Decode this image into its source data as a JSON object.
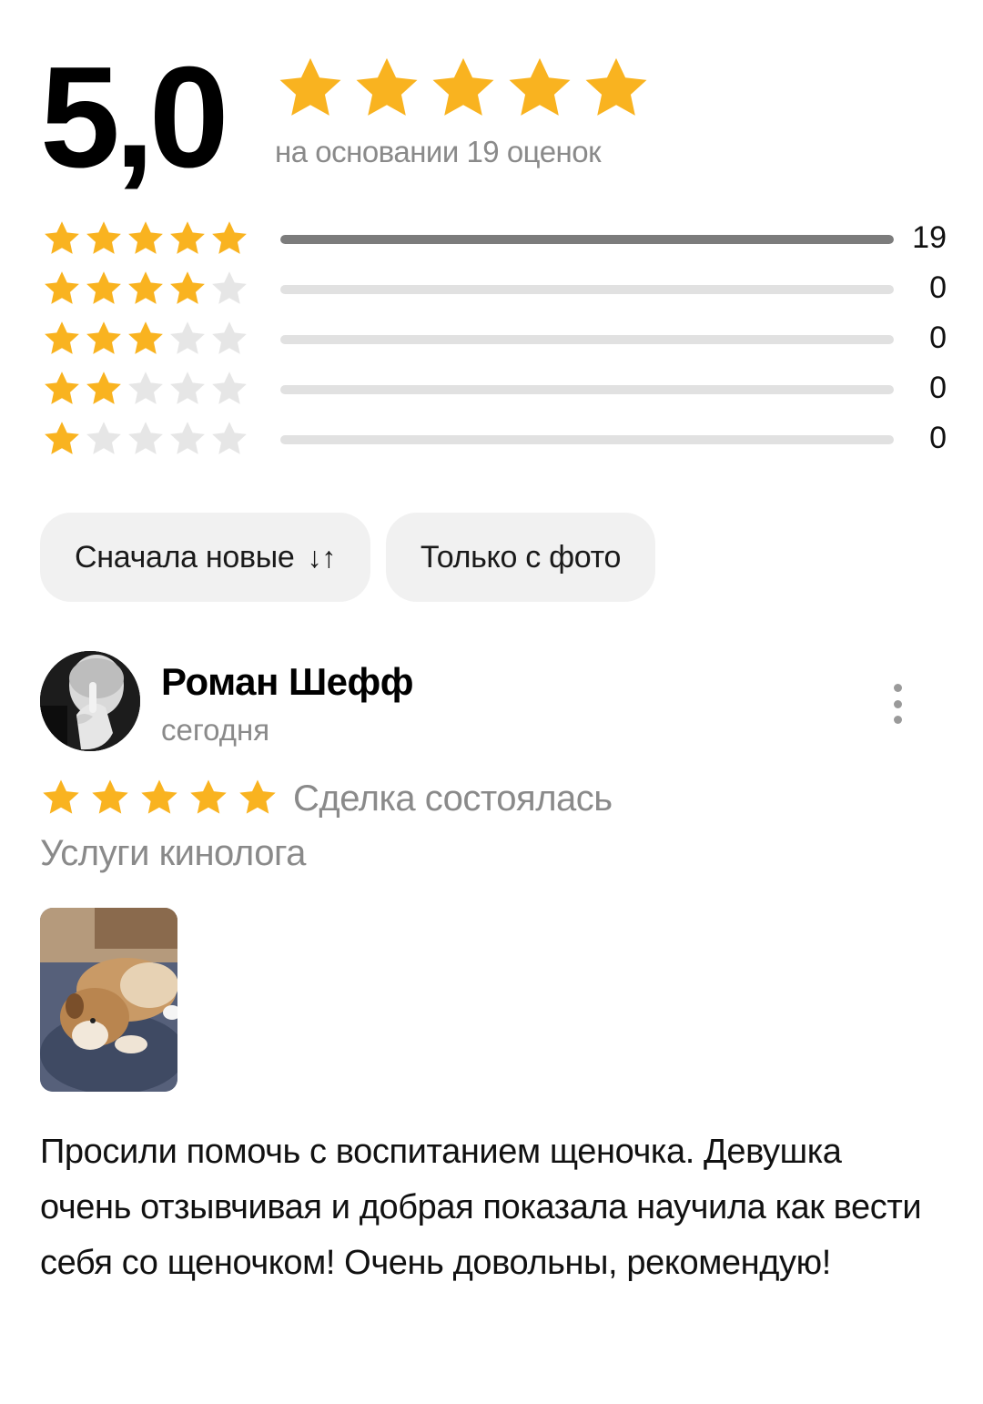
{
  "colors": {
    "star_filled": "#F9B320",
    "star_empty": "#E6E6E6",
    "bar_filled": "#7C7C7C",
    "bar_empty": "#E1E1E1"
  },
  "summary": {
    "rating": "5,0",
    "stars": 5,
    "caption": "на основании 19 оценок"
  },
  "distribution": [
    {
      "stars": 5,
      "count": "19",
      "fraction": 1.0
    },
    {
      "stars": 4,
      "count": "0",
      "fraction": 0
    },
    {
      "stars": 3,
      "count": "0",
      "fraction": 0
    },
    {
      "stars": 2,
      "count": "0",
      "fraction": 0
    },
    {
      "stars": 1,
      "count": "0",
      "fraction": 0
    }
  ],
  "filters": {
    "sort_label": "Сначала новые",
    "sort_icon": "↓↑",
    "photo_only_label": "Только с фото"
  },
  "review": {
    "author": "Роман Шефф",
    "date": "сегодня",
    "stars": 5,
    "deal_status": "Сделка состоялась",
    "service": "Услуги кинолога",
    "text": "Просили помочь с воспитанием щеночка. Девушка очень отзывчивая и добрая показала научила как вести себя со щеночком! Очень довольны, рекомендую!"
  }
}
